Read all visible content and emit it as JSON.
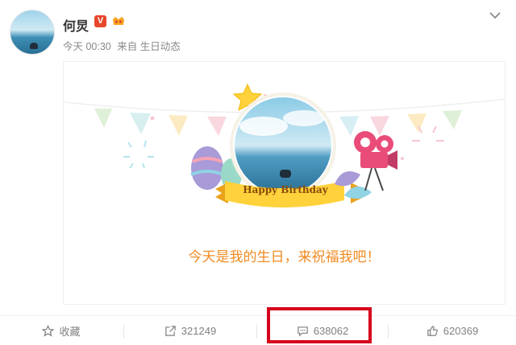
{
  "post": {
    "author": "何炅",
    "verified_badge": "V",
    "time": "今天 00:30",
    "source": "来自 生日动态"
  },
  "card": {
    "banner_text": "Happy Birthday",
    "message": "今天是我的生日，来祝福我吧！"
  },
  "actions": {
    "favorite_label": "收藏",
    "repost_count": "321249",
    "comment_count": "638062",
    "like_count": "620369"
  },
  "colors": {
    "highlight": "#d6001c",
    "message": "#f08b22",
    "badge": "#e8462d"
  }
}
